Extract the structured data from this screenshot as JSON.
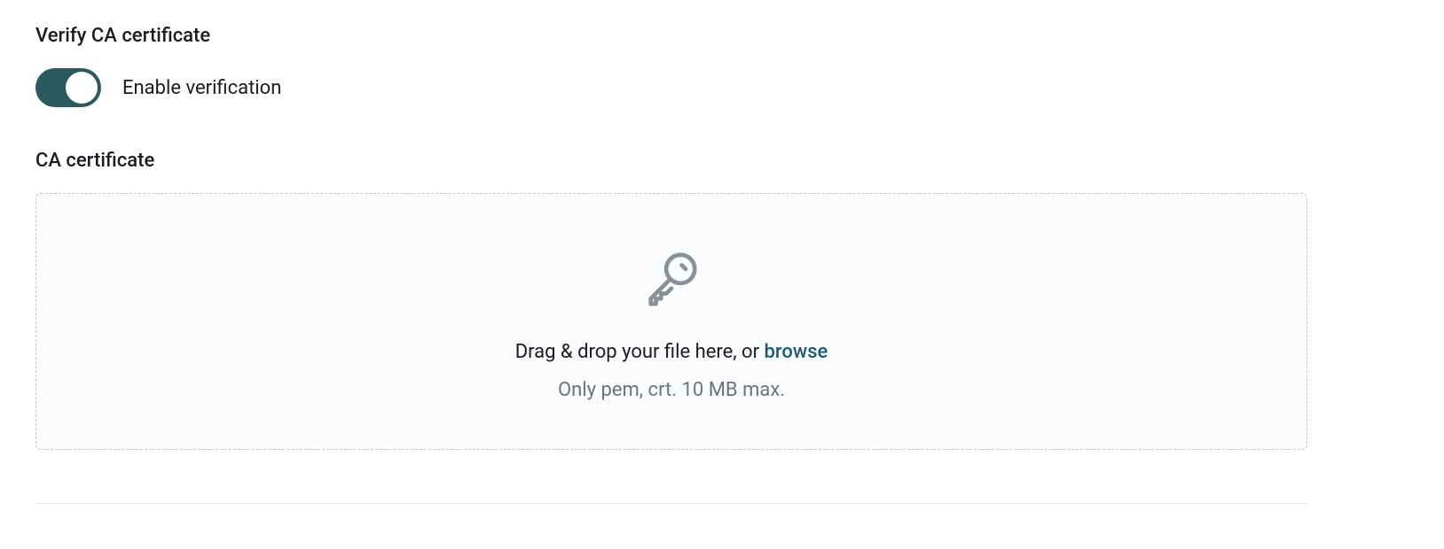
{
  "verify": {
    "title": "Verify CA certificate",
    "toggle_label": "Enable verification",
    "toggle_on": true
  },
  "upload": {
    "title": "CA certificate",
    "drop_text": "Drag & drop your file here, or ",
    "browse_label": "browse",
    "hint": "Only pem, crt. 10 MB max."
  },
  "colors": {
    "toggle_bg": "#2a5a5e",
    "browse_link": "#1d5a7a",
    "icon_stroke": "#8a9099"
  }
}
